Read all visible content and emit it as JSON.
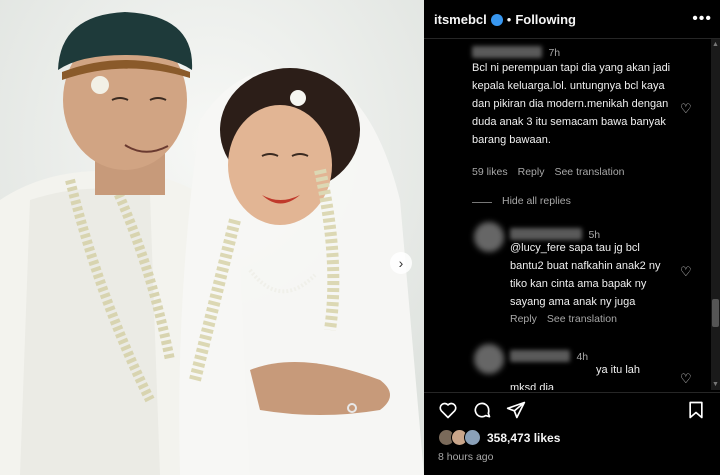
{
  "header": {
    "username": "itsmebcl",
    "separator": "•",
    "follow_label": "Following",
    "more_label": "•••"
  },
  "comments": [
    {
      "time": "7h",
      "text": "Bcl ni perempuan tapi dia yang akan jadi kepala keluarga.lol. untungnya bcl kaya dan pikiran dia modern.menikah dengan duda anak 3 itu semacam bawa banyak barang bawaan.",
      "likes": "59 likes",
      "reply": "Reply",
      "translate": "See translation",
      "hide_replies": "Hide all replies"
    },
    {
      "time": "5h",
      "text": "@lucy_fere sapa tau jg bcl bantu2 buat nafkahin anak2 ny tiko kan cinta ama bapak ny sayang ama anak ny juga",
      "reply": "Reply",
      "translate": "See translation"
    },
    {
      "time": "4h",
      "text": "ya itu lah mksd dia"
    }
  ],
  "footer": {
    "likes": "358,473 likes",
    "time": "8 hours ago"
  },
  "icons": {
    "heart": "heart-icon",
    "comment": "comment-icon",
    "share": "share-icon",
    "bookmark": "bookmark-icon"
  },
  "colors": {
    "background": "#000000",
    "verified": "#3897f0",
    "muted": "#a8a8a8"
  }
}
